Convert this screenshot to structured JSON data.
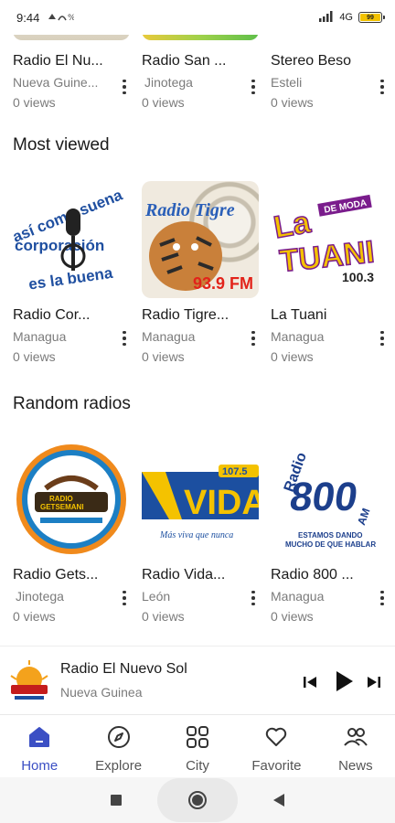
{
  "status_bar": {
    "time": "9:44",
    "network": "4G",
    "battery": "99"
  },
  "top_row": [
    {
      "name": "Radio El Nu...",
      "city": "Nueva Guine...",
      "views": "0 views"
    },
    {
      "name": "Radio San ...",
      "city": "Jinotega",
      "views": "0 views"
    },
    {
      "name": "Stereo Beso",
      "city": "Esteli",
      "views": "0 views"
    }
  ],
  "most_viewed": {
    "title": "Most viewed",
    "items": [
      {
        "name": "Radio Cor...",
        "city": "Managua",
        "views": "0 views",
        "art_text": [
          "así como suena",
          "corporación",
          "es la buena"
        ]
      },
      {
        "name": "Radio Tigre...",
        "city": "Managua",
        "views": "0 views",
        "art_text": [
          "Radio Tigre",
          "93.9 FM"
        ]
      },
      {
        "name": "La Tuani",
        "city": "Managua",
        "views": "0 views",
        "art_text": [
          "La",
          "TUANI",
          "DE MODA",
          "100.3"
        ]
      }
    ]
  },
  "random_radios": {
    "title": "Random radios",
    "items": [
      {
        "name": "Radio Gets...",
        "city": "Jinotega",
        "views": "0 views",
        "art_text": [
          "RADIO",
          "GETSEMANI"
        ]
      },
      {
        "name": "Radio Vida...",
        "city": "León",
        "views": "0 views",
        "art_text": [
          "107.5",
          "VIDA",
          "Más viva que nunca"
        ]
      },
      {
        "name": "Radio 800 ...",
        "city": "Managua",
        "views": "0 views",
        "art_text": [
          "Radio",
          "800",
          "AM",
          "ESTAMOS DANDO",
          "MUCHO DE QUE HABLAR"
        ]
      }
    ]
  },
  "mini_player": {
    "title": "Radio El Nuevo Sol",
    "subtitle": "Nueva Guinea"
  },
  "bottom_nav": [
    {
      "label": "Home",
      "icon": "home-icon",
      "active": true
    },
    {
      "label": "Explore",
      "icon": "compass-icon",
      "active": false
    },
    {
      "label": "City",
      "icon": "grid-icon",
      "active": false
    },
    {
      "label": "Favorite",
      "icon": "heart-icon",
      "active": false
    },
    {
      "label": "News",
      "icon": "people-icon",
      "active": false
    }
  ],
  "colors": {
    "accent": "#3b4fc4",
    "text": "#1a1a1a",
    "muted": "#7b7b7b"
  }
}
